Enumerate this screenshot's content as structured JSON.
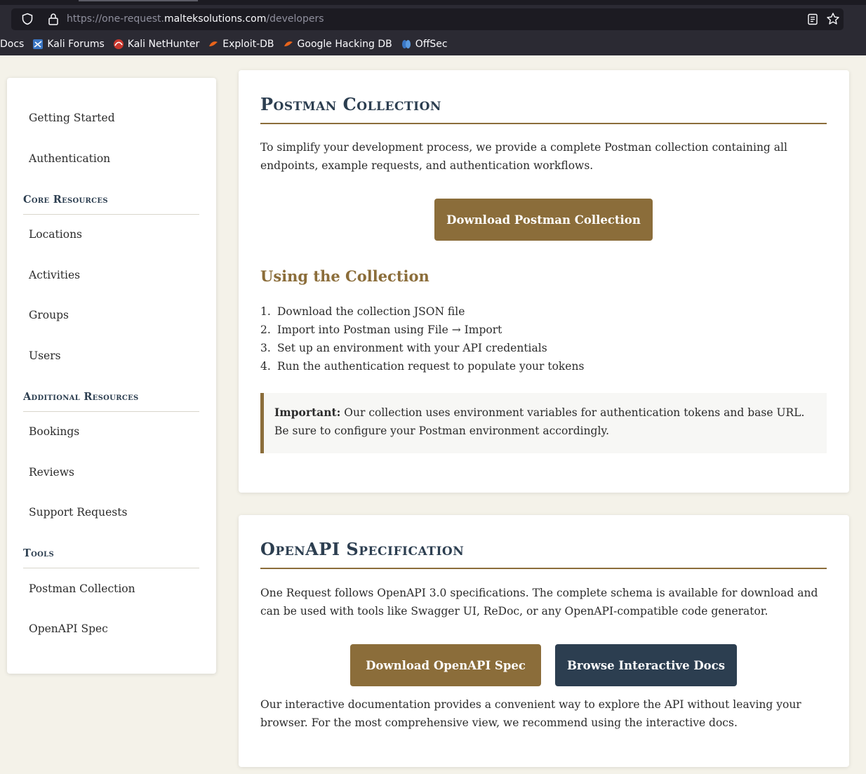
{
  "browser": {
    "url_prefix": "https://one-request.",
    "url_host": "malteksolutions.com",
    "url_path": "/developers",
    "bookmarks": [
      {
        "label": "Docs"
      },
      {
        "label": "Kali Forums"
      },
      {
        "label": "Kali NetHunter"
      },
      {
        "label": "Exploit-DB"
      },
      {
        "label": "Google Hacking DB"
      },
      {
        "label": "OffSec"
      }
    ]
  },
  "sidebar": {
    "getting_started": "Getting Started",
    "authentication": "Authentication",
    "core_heading": "Core Resources",
    "core_items": [
      "Locations",
      "Activities",
      "Groups",
      "Users"
    ],
    "additional_heading": "Additional Resources",
    "additional_items": [
      "Bookings",
      "Reviews",
      "Support Requests"
    ],
    "tools_heading": "Tools",
    "tools_items": [
      "Postman Collection",
      "OpenAPI Spec"
    ]
  },
  "postman": {
    "title": "Postman Collection",
    "intro": "To simplify your development process, we provide a complete Postman collection containing all endpoints, example requests, and authentication workflows.",
    "download_label": "Download Postman Collection",
    "using_heading": "Using the Collection",
    "steps": [
      "Download the collection JSON file",
      "Import into Postman using File → Import",
      "Set up an environment with your API credentials",
      "Run the authentication request to populate your tokens"
    ],
    "important_label": "Important:",
    "important_text": "Our collection uses environment variables for authentication tokens and base URL. Be sure to configure your Postman environment accordingly."
  },
  "openapi": {
    "title": "OpenAPI Specification",
    "intro": "One Request follows OpenAPI 3.0 specifications. The complete schema is available for download and can be used with tools like Swagger UI, ReDoc, or any OpenAPI-compatible code generator.",
    "download_label": "Download OpenAPI Spec",
    "browse_label": "Browse Interactive Docs",
    "outro": "Our interactive documentation provides a convenient way to explore the API without leaving your browser. For the most comprehensive view, we recommend using the interactive docs."
  },
  "colors": {
    "accent_gold": "#8b6d3a",
    "navy": "#2c3e50",
    "page_bg": "#f4f2e9"
  }
}
